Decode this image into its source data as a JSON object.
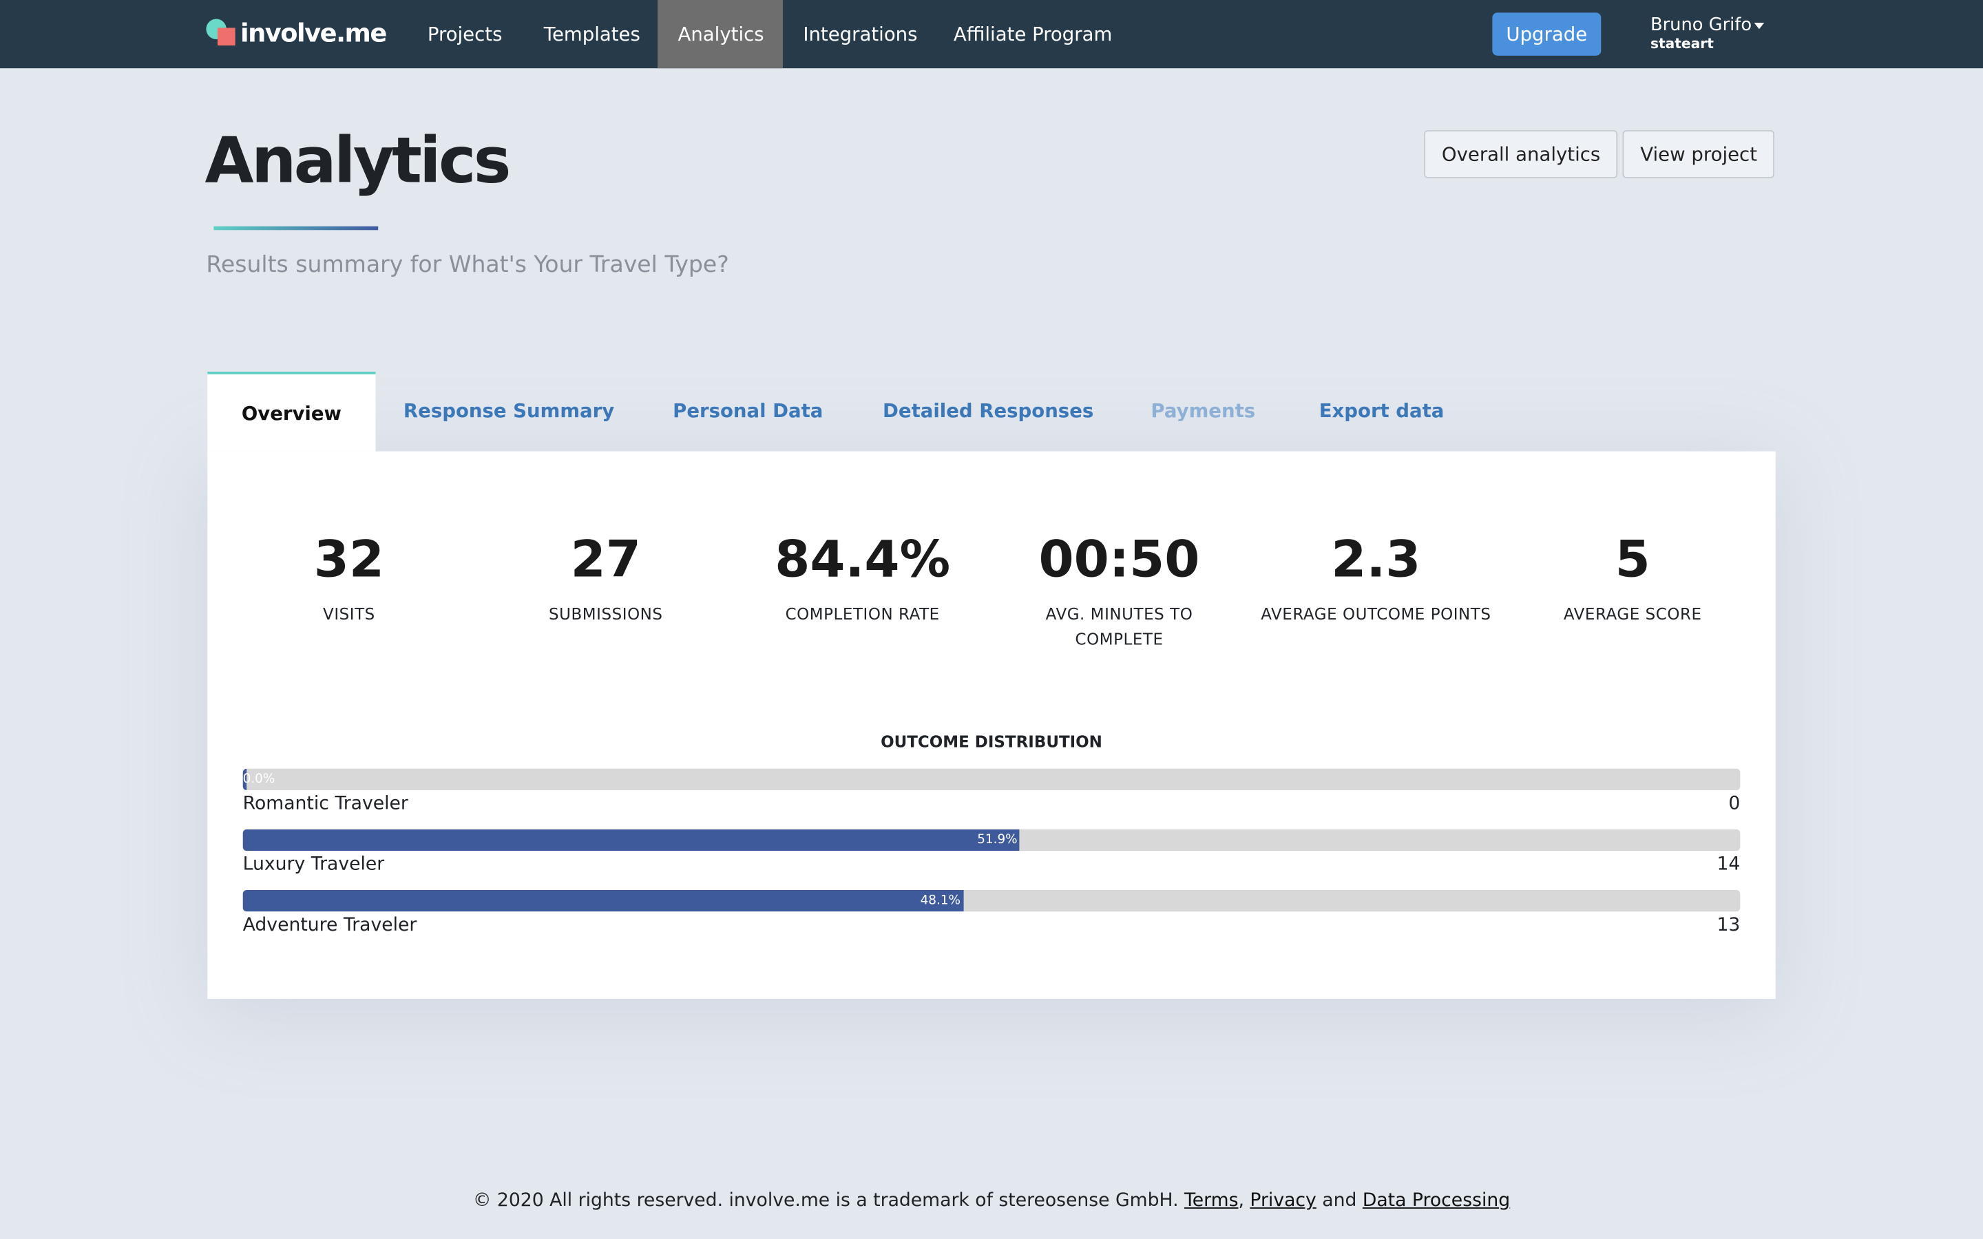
{
  "nav": {
    "logo": "involve.me",
    "items": [
      "Projects",
      "Templates",
      "Analytics",
      "Integrations",
      "Affiliate Program"
    ],
    "active": "Analytics",
    "upgrade": "Upgrade",
    "user_name": "Bruno Grifo",
    "user_handle": "stateart"
  },
  "header": {
    "title": "Analytics",
    "subtitle": "Results summary for What's Your Travel Type?",
    "overall_btn": "Overall analytics",
    "view_btn": "View project"
  },
  "tabs": [
    {
      "label": "Overview",
      "state": "active"
    },
    {
      "label": "Response Summary"
    },
    {
      "label": "Personal Data"
    },
    {
      "label": "Detailed Responses"
    },
    {
      "label": "Payments",
      "state": "disabled"
    },
    {
      "label": "Export data"
    }
  ],
  "stats": [
    {
      "value": "32",
      "label": "VISITS"
    },
    {
      "value": "27",
      "label": "SUBMISSIONS"
    },
    {
      "value": "84.4%",
      "label": "COMPLETION RATE"
    },
    {
      "value": "00:50",
      "label": "AVG. MINUTES TO COMPLETE"
    },
    {
      "value": "2.3",
      "label": "AVERAGE OUTCOME POINTS"
    },
    {
      "value": "5",
      "label": "AVERAGE SCORE"
    }
  ],
  "outcome": {
    "title": "OUTCOME DISTRIBUTION",
    "bar_color": "#3f5a9b",
    "rows": [
      {
        "name": "Romantic Traveler",
        "percent": 0.0,
        "percent_label": "0.0%",
        "count": "0"
      },
      {
        "name": "Luxury Traveler",
        "percent": 51.9,
        "percent_label": "51.9%",
        "count": "14"
      },
      {
        "name": "Adventure Traveler",
        "percent": 48.1,
        "percent_label": "48.1%",
        "count": "13"
      }
    ]
  },
  "footer": {
    "text": "© 2020 All rights reserved. involve.me is a trademark of stereosense GmbH.",
    "terms": "Terms",
    "sep": ",",
    "privacy": "Privacy",
    "and": "and",
    "data_processing": "Data Processing"
  }
}
